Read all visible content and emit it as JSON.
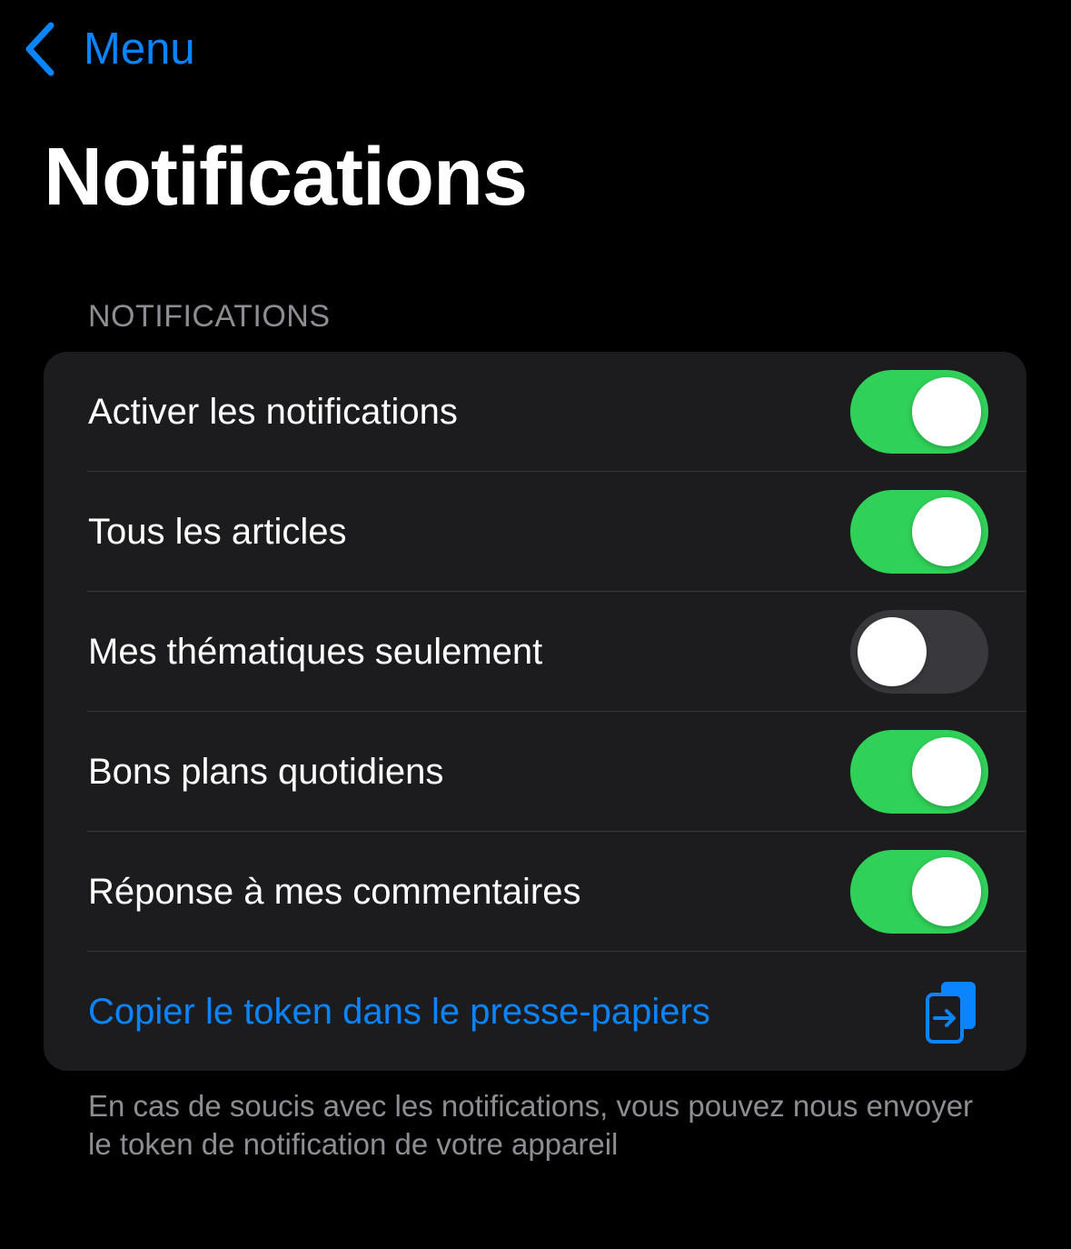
{
  "nav": {
    "back_label": "Menu"
  },
  "page": {
    "title": "Notifications"
  },
  "section": {
    "header": "NOTIFICATIONS",
    "rows": [
      {
        "label": "Activer les notifications",
        "on": true
      },
      {
        "label": "Tous les articles",
        "on": true
      },
      {
        "label": "Mes thématiques seulement",
        "on": false
      },
      {
        "label": "Bons plans quotidiens",
        "on": true
      },
      {
        "label": "Réponse à mes commentaires",
        "on": true
      }
    ],
    "action": {
      "label": "Copier le token dans le presse-papiers",
      "icon": "copy-to-clipboard-icon"
    },
    "footer": "En cas de soucis avec les notifications, vous pouvez nous envoyer le token de notification de votre appareil"
  },
  "colors": {
    "background": "#000000",
    "group_background": "#1c1c1e",
    "accent": "#0a84ff",
    "toggle_on": "#30d158",
    "toggle_off": "#39393d",
    "secondary_text": "#8d8d93"
  }
}
